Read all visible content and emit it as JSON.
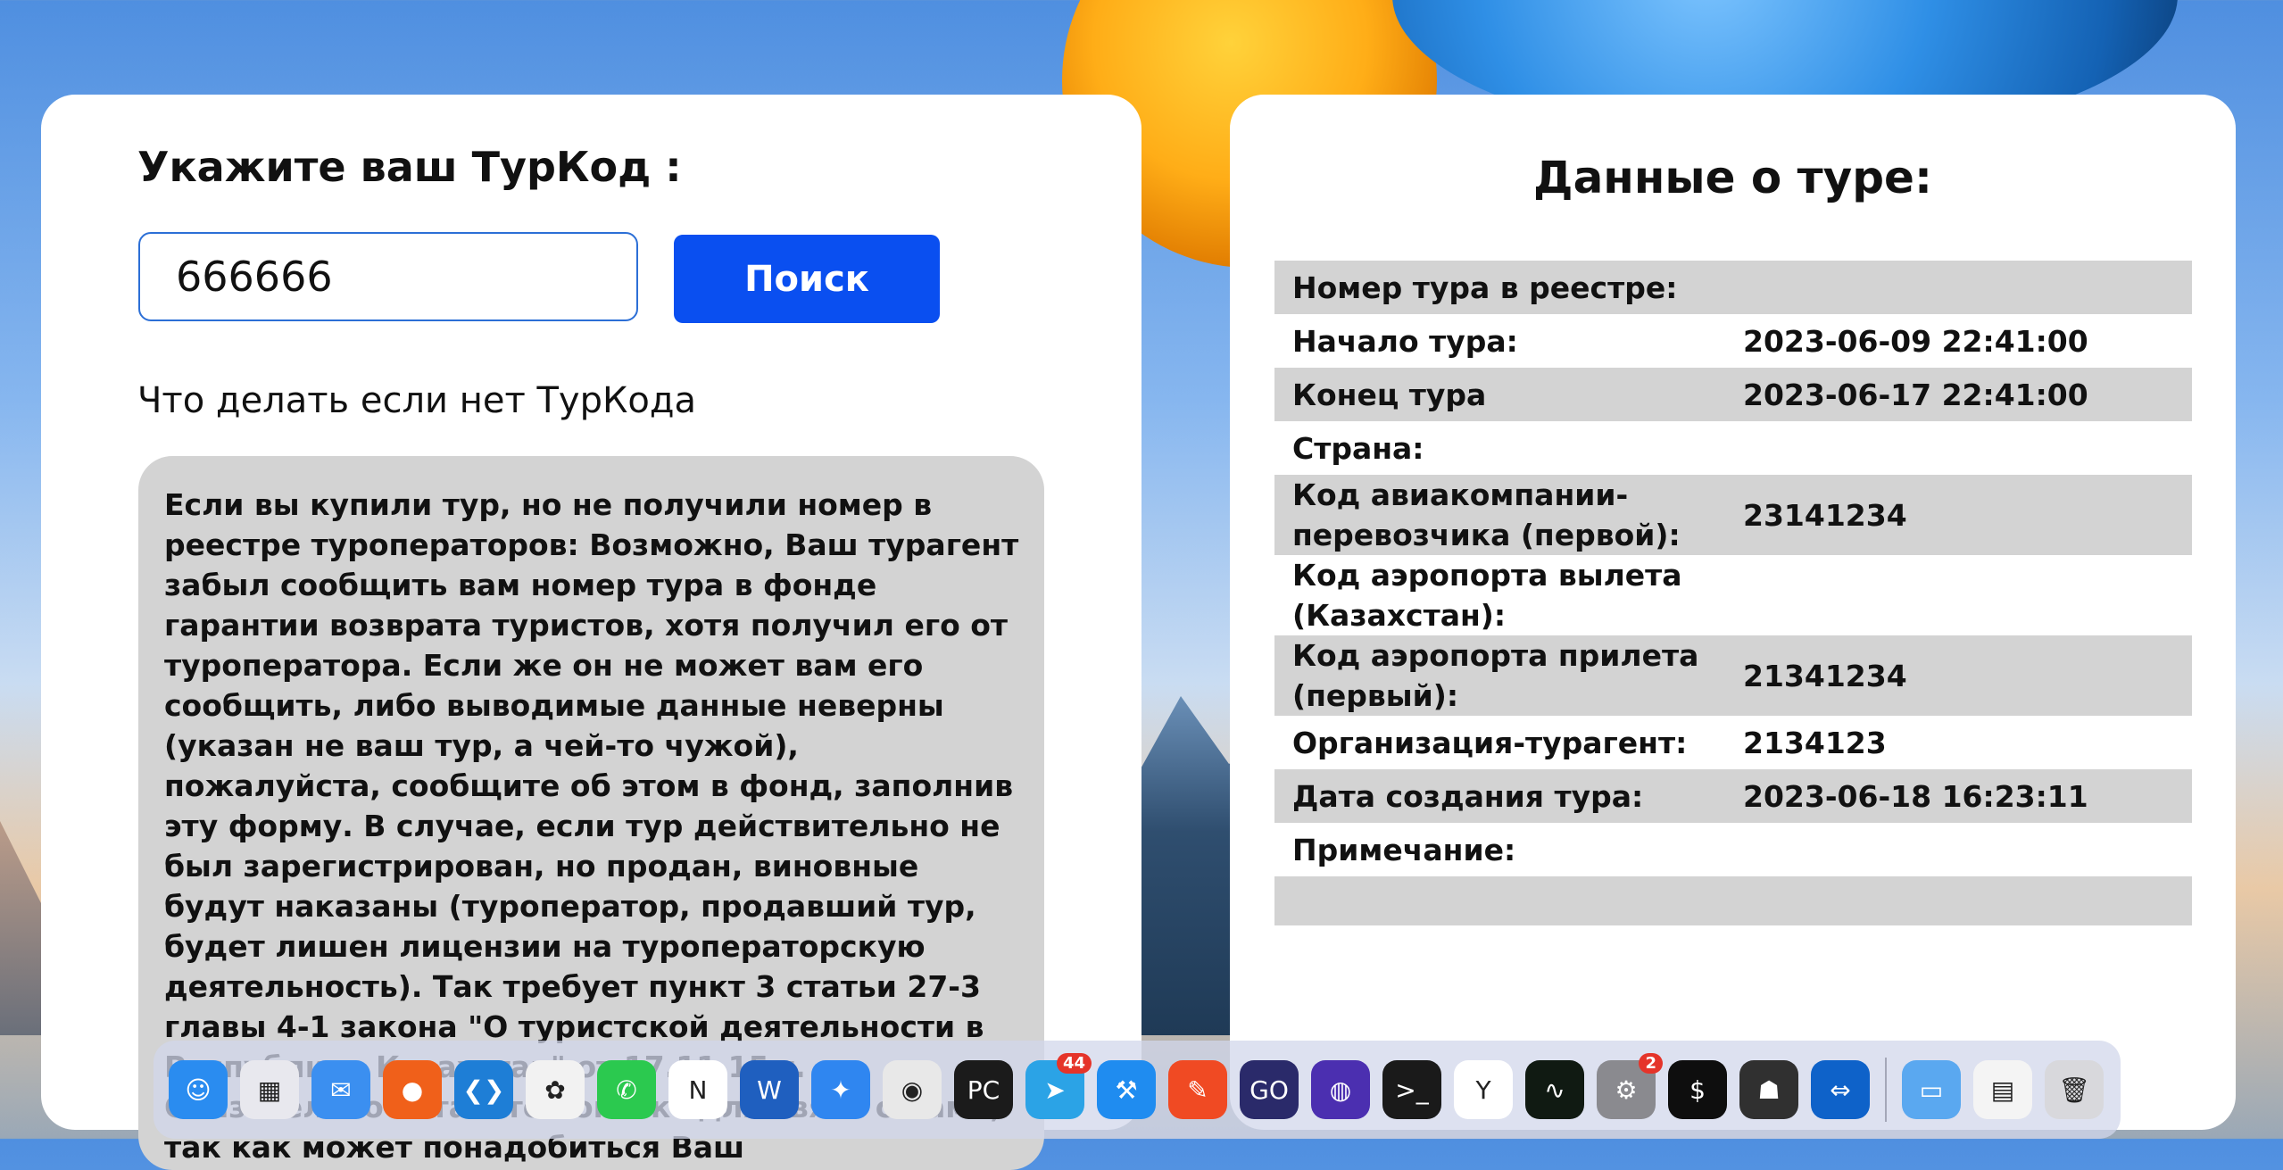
{
  "search": {
    "title": "Укажите ваш ТурКод :",
    "input_value": "666666",
    "button_label": "Поиск"
  },
  "help": {
    "title": "Что делать если нет ТурКода",
    "text": "Если вы купили тур, но не получили номер в реестре туроператоров: Возможно, Ваш турагент забыл сообщить вам номер тура в фонде гарантии возврата туристов, хотя получил его от туроператора. Если же он не может вам его сообщить, либо выводимые данные неверны (указан не ваш тур, а чей-то чужой), пожалуйста, сообщите об этом в фонд, заполнив эту форму. В случае, если тур действительно не был зарегистрирован, но продан, виновные будут наказаны (туроператор, продавший тур, будет лишен лицензии на туроператорскую деятельность). Так требует пункт 3 статьи 27-3 главы 4-1 закона \"О туристской деятельности в Республике Казахстан\" от 17.11.15 г. Обязательно оставьте контакт для связи с Вами, так как может понадобиться Ваш"
  },
  "details": {
    "title": "Данные о туре:",
    "rows": [
      {
        "key": "Номер тура в реестре:",
        "value": ""
      },
      {
        "key": "Начало тура:",
        "value": "2023-06-09 22:41:00"
      },
      {
        "key": "Конец тура",
        "value": "2023-06-17 22:41:00"
      },
      {
        "key": "Страна:",
        "value": ""
      },
      {
        "key": "Код авиакомпании-перевозчика (первой):",
        "value": "23141234"
      },
      {
        "key": "Код аэропорта вылета (Казахстан):",
        "value": ""
      },
      {
        "key": "Код аэропорта прилета (первый):",
        "value": "21341234"
      },
      {
        "key": "Организация-турагент:",
        "value": "2134123"
      },
      {
        "key": "Дата создания тура:",
        "value": "2023-06-18 16:23:11"
      },
      {
        "key": "Примечание:",
        "value": ""
      }
    ]
  },
  "dock": {
    "apps": [
      {
        "name": "finder-icon",
        "glyph": "☺",
        "color": "#2a8cf0"
      },
      {
        "name": "launchpad-icon",
        "glyph": "▦",
        "color": "#e8e8ee"
      },
      {
        "name": "mail-icon",
        "glyph": "✉",
        "color": "#3b8ff0"
      },
      {
        "name": "firefox-icon",
        "glyph": "●",
        "color": "#f0601a"
      },
      {
        "name": "vscode-icon",
        "glyph": "❮❯",
        "color": "#1e7ed6"
      },
      {
        "name": "photos-icon",
        "glyph": "✿",
        "color": "#f2f2f2"
      },
      {
        "name": "whatsapp-icon",
        "glyph": "✆",
        "color": "#2bc94f"
      },
      {
        "name": "notion-icon",
        "glyph": "N",
        "color": "#ffffff"
      },
      {
        "name": "word-icon",
        "glyph": "W",
        "color": "#1f5fbf"
      },
      {
        "name": "safari-icon",
        "glyph": "✦",
        "color": "#2f86f0"
      },
      {
        "name": "chrome-icon",
        "glyph": "◉",
        "color": "#e8e8e8"
      },
      {
        "name": "pycharm-icon",
        "glyph": "PC",
        "color": "#1b1b1b"
      },
      {
        "name": "telegram-icon",
        "glyph": "➤",
        "color": "#2ba3e6",
        "badge": "44"
      },
      {
        "name": "xcode-icon",
        "glyph": "⚒",
        "color": "#1f8cf0"
      },
      {
        "name": "paw-icon",
        "glyph": "✎",
        "color": "#f04a23"
      },
      {
        "name": "goland-icon",
        "glyph": "GO",
        "color": "#2a2a6a"
      },
      {
        "name": "preview-app-icon",
        "glyph": "◍",
        "color": "#4b2fb0"
      },
      {
        "name": "terminal-icon",
        "glyph": ">_",
        "color": "#1a1a1a"
      },
      {
        "name": "yandex-browser-icon",
        "glyph": "Y",
        "color": "#ffffff"
      },
      {
        "name": "activity-monitor-icon",
        "glyph": "∿",
        "color": "#101a12"
      },
      {
        "name": "system-settings-icon",
        "glyph": "⚙",
        "color": "#8a8a8f",
        "badge": "2"
      },
      {
        "name": "iterm-icon",
        "glyph": "$",
        "color": "#0e0e0e"
      },
      {
        "name": "helmet-app-icon",
        "glyph": "☗",
        "color": "#303030"
      },
      {
        "name": "teamviewer-icon",
        "glyph": "⇔",
        "color": "#0e62c9"
      }
    ],
    "extras": [
      {
        "name": "downloads-folder-icon",
        "glyph": "▭",
        "color": "#5aa8f0"
      },
      {
        "name": "document-preview-icon",
        "glyph": "▤",
        "color": "#f4f4f4"
      },
      {
        "name": "trash-icon",
        "glyph": "🗑",
        "color": "#d8d8dc"
      }
    ]
  }
}
